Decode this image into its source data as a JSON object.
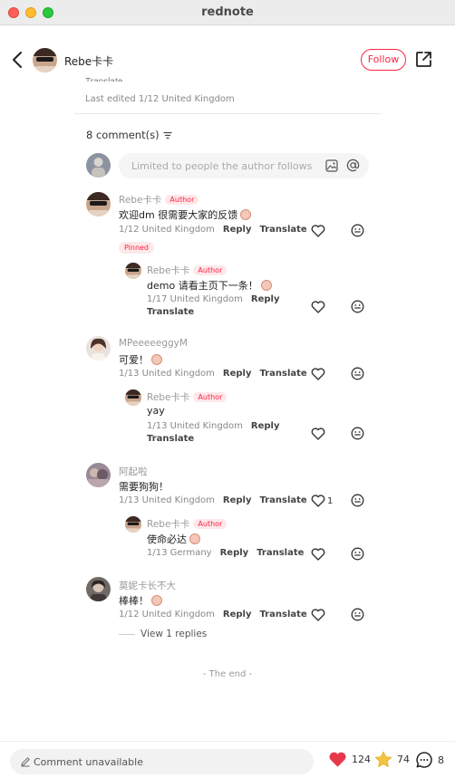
{
  "window": {
    "title": "rednote"
  },
  "header": {
    "author_name": "Rebe卡卡",
    "follow_label": "Follow"
  },
  "post": {
    "truncated_text": "Translate",
    "last_edited": "Last edited 1/12 United Kingdom"
  },
  "comments_header": {
    "count_label": "8 comment(s)"
  },
  "comment_input": {
    "placeholder": "Limited to people the author follows"
  },
  "labels": {
    "reply": "Reply",
    "translate": "Translate",
    "author": "Author",
    "pinned": "Pinned"
  },
  "comments": [
    {
      "name": "Rebe卡卡",
      "text": "欢迎dm 很需要大家的反馈",
      "meta": "1/12 United Kingdom",
      "likes": "",
      "reply": {
        "name": "Rebe卡卡",
        "text": "demo 请看主页下一条！",
        "meta": "1/17 United Kingdom"
      }
    },
    {
      "name": "MPeeeeeggyM",
      "text": "可爱！",
      "meta": "1/13 United Kingdom",
      "likes": "",
      "reply": {
        "name": "Rebe卡卡",
        "text": "yay",
        "meta": "1/13 United Kingdom"
      }
    },
    {
      "name": "阿起啦",
      "text": "需要狗狗！",
      "meta": "1/13 United Kingdom",
      "likes": "1",
      "reply": {
        "name": "Rebe卡卡",
        "text": "使命必达",
        "meta": "1/13 Germany"
      }
    },
    {
      "name": "莫妮卡长不大",
      "text": "棒棒！",
      "meta": "1/12 United Kingdom",
      "likes": ""
    }
  ],
  "view_replies": "View 1 replies",
  "end_label": "- The end -",
  "bottom": {
    "input_placeholder": "Comment unavailable",
    "likes": "124",
    "collects": "74",
    "comments": "8"
  },
  "colors": {
    "accent": "#ff2442",
    "badge_bg": "#fde8ea",
    "star": "#f5c342"
  }
}
